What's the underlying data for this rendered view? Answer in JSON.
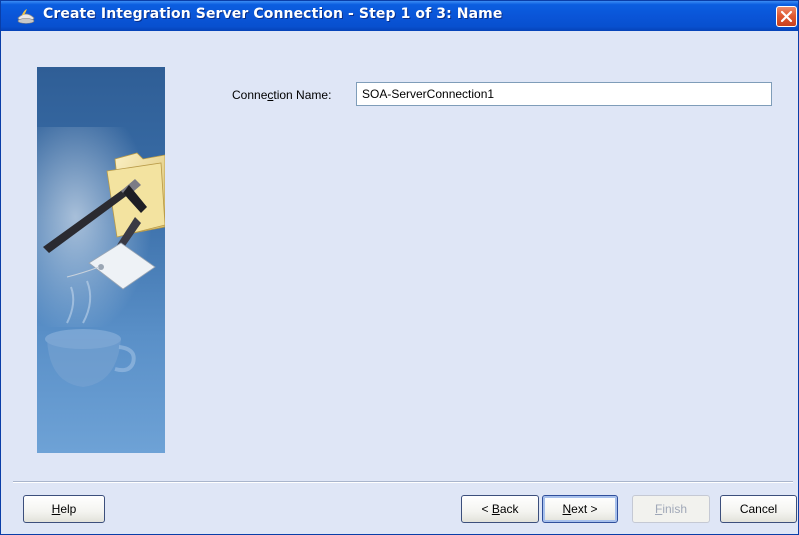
{
  "window": {
    "title": "Create Integration Server Connection - Step 1 of 3: Name"
  },
  "form": {
    "connection_name_label_pre": "Conne",
    "connection_name_label_mnemonic": "c",
    "connection_name_label_post": "tion Name:",
    "connection_name_value": "SOA-ServerConnection1"
  },
  "buttons": {
    "help_mnemonic": "H",
    "help_rest": "elp",
    "back_pre": "< ",
    "back_mnemonic": "B",
    "back_rest": "ack",
    "next_mnemonic": "N",
    "next_rest": "ext >",
    "finish_mnemonic": "F",
    "finish_rest": "inish",
    "cancel_label": "Cancel"
  },
  "colors": {
    "titlebar": "#0a55d8",
    "dialog_background": "#dfe6f6",
    "close_button": "#e05a32",
    "side_panel": "#3b6eaa"
  },
  "icons": {
    "title": "oracle-jdeveloper-icon",
    "close": "close-icon",
    "side_image": "folder-pen-cup-illustration"
  }
}
